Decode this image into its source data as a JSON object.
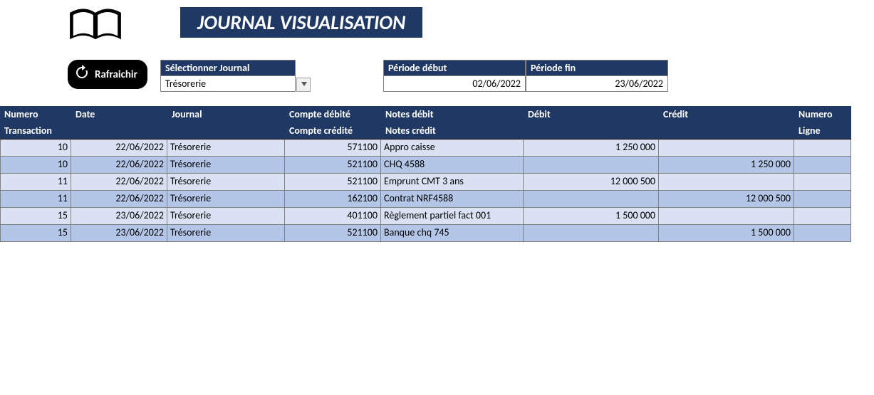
{
  "header": {
    "title": "JOURNAL VISUALISATION"
  },
  "toolbar": {
    "refresh_label": "Rafraichir",
    "selector_label": "Sélectionner Journal",
    "selector_value": "Trésorerie",
    "period_start_label": "Période début",
    "period_start_value": "02/06/2022",
    "period_end_label": "Période fin",
    "period_end_value": "23/06/2022"
  },
  "table": {
    "headers": {
      "col1a": "Numero",
      "col1b": "Transaction",
      "col2a": "Date",
      "col2b": "",
      "col3a": "Journal",
      "col3b": "",
      "col4a": "Compte débité",
      "col4b": "Compte crédité",
      "col5a": "Notes débit",
      "col5b": "Notes crédit",
      "col6a": "Débit",
      "col6b": "",
      "col7a": "Crédit",
      "col7b": "",
      "col8a": "Numero",
      "col8b": "Ligne"
    },
    "rows": [
      {
        "tone": "a",
        "num": "10",
        "date": "22/06/2022",
        "journal": "Trésorerie",
        "account": "571100",
        "notes": "Appro caisse",
        "debit": "1 250 000",
        "credit": "",
        "line": ""
      },
      {
        "tone": "b",
        "num": "10",
        "date": "22/06/2022",
        "journal": "Trésorerie",
        "account": "521100",
        "notes": "CHQ 4588",
        "debit": "",
        "credit": "1 250 000",
        "line": ""
      },
      {
        "tone": "a",
        "num": "11",
        "date": "22/06/2022",
        "journal": "Trésorerie",
        "account": "521100",
        "notes": "Emprunt CMT 3 ans",
        "debit": "12 000 500",
        "credit": "",
        "line": ""
      },
      {
        "tone": "b",
        "num": "11",
        "date": "22/06/2022",
        "journal": "Trésorerie",
        "account": "162100",
        "notes": "Contrat NRF4588",
        "debit": "",
        "credit": "12 000 500",
        "line": ""
      },
      {
        "tone": "a",
        "num": "15",
        "date": "23/06/2022",
        "journal": "Trésorerie",
        "account": "401100",
        "notes": "Règlement partiel fact 001",
        "debit": "1 500 000",
        "credit": "",
        "line": ""
      },
      {
        "tone": "b",
        "num": "15",
        "date": "23/06/2022",
        "journal": "Trésorerie",
        "account": "521100",
        "notes": "Banque chq 745",
        "debit": "",
        "credit": "1 500 000",
        "line": ""
      }
    ]
  }
}
